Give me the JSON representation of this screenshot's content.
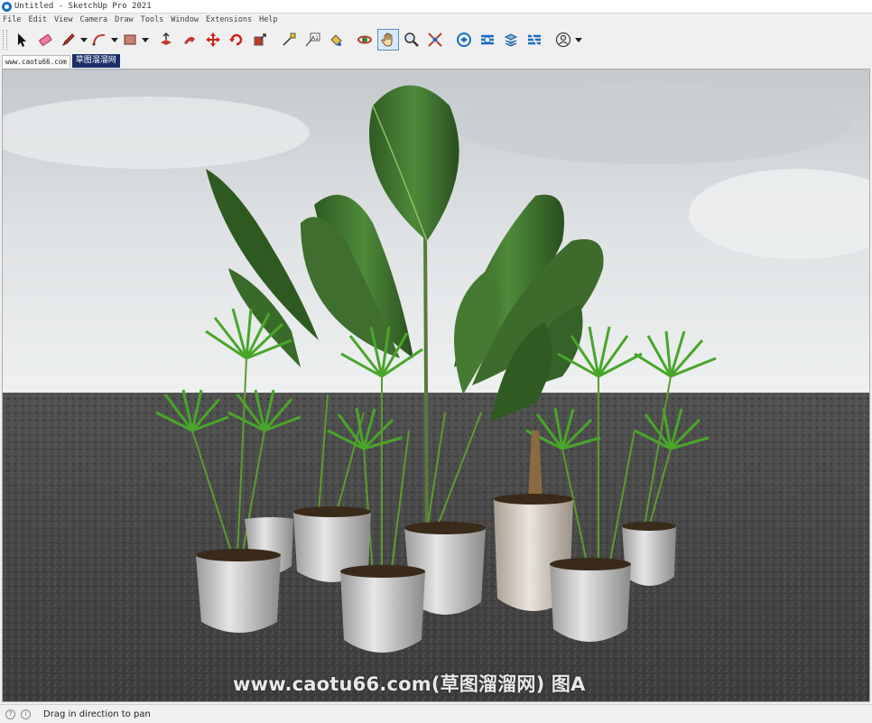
{
  "window": {
    "title": "Untitled - SketchUp Pro 2021"
  },
  "menu": [
    "File",
    "Edit",
    "View",
    "Camera",
    "Draw",
    "Tools",
    "Window",
    "Extensions",
    "Help"
  ],
  "tabs": [
    {
      "label": "www.caotu66.com",
      "active": false
    },
    {
      "label": "草图溜溜网",
      "active": true
    }
  ],
  "toolbar": {
    "tools": [
      "select-tool",
      "eraser-tool",
      "line-tool",
      "arc-tool",
      "rectangle-tool",
      "push-pull-tool",
      "follow-me-tool",
      "move-tool",
      "rotate-tool",
      "scale-tool",
      "tape-measure-tool",
      "text-tool",
      "paint-bucket-tool",
      "orbit-tool",
      "pan-tool",
      "zoom-tool",
      "zoom-extents-tool",
      "warehouse-tool",
      "extension-warehouse-tool",
      "layout-tool",
      "extension-manager-tool",
      "account-tool"
    ],
    "active_tool": "pan-tool"
  },
  "viewport": {
    "watermark": "www.caotu66.com(草图溜溜网) 图A",
    "sky_color": "#d9dde0",
    "ground_color": "#4a4a4a"
  },
  "status": {
    "message": "Drag in direction to pan"
  },
  "colors": {
    "accent": "#1b2f6b",
    "active_tool_bg": "#d9e8f7"
  }
}
